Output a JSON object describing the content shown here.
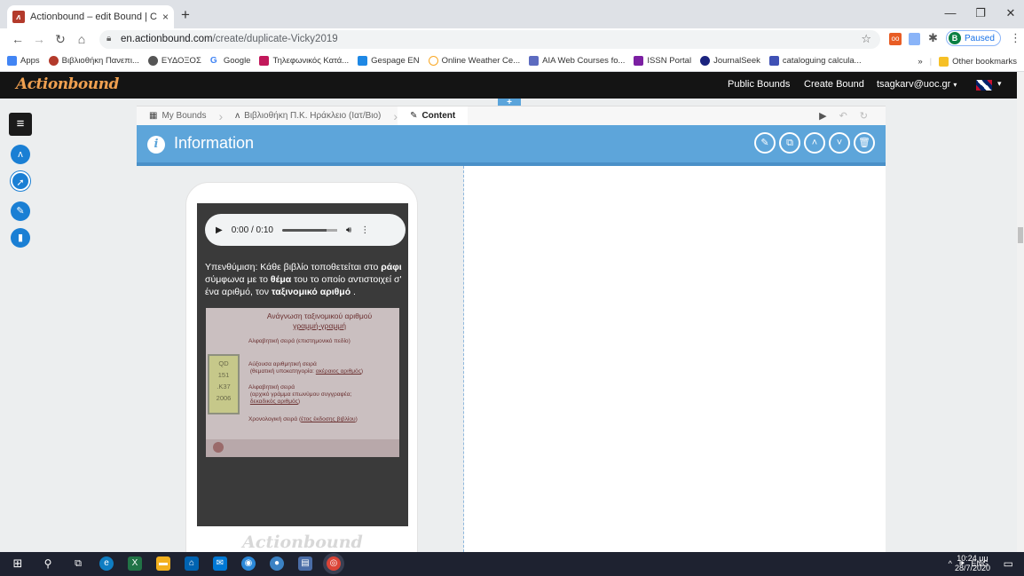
{
  "browser": {
    "tab_title": "Actionbound – edit Bound | Crea",
    "tab_close": "×",
    "new_tab": "+",
    "url_host": "en.actionbound.com",
    "url_path": "/create/duplicate-Vicky2019",
    "profile_letter": "B",
    "profile_status": "Paused",
    "bookmarks": [
      {
        "label": "Apps",
        "color": "#4285f4"
      },
      {
        "label": "Βιβλιοθήκη Πανεπι...",
        "color": "#b33a2b"
      },
      {
        "label": "ΕΥΔΟΞΟΣ",
        "color": "#555555"
      },
      {
        "label": "Google",
        "color": "#4285f4"
      },
      {
        "label": "Τηλεφωνικός Κατά...",
        "color": "#c2185b"
      },
      {
        "label": "Gespage EN",
        "color": "#1e88e5"
      },
      {
        "label": "Online Weather Ce...",
        "color": "#f9a825"
      },
      {
        "label": "AIA Web Courses fo...",
        "color": "#5c6bc0"
      },
      {
        "label": "ISSN Portal",
        "color": "#7b1fa2"
      },
      {
        "label": "JournalSeek",
        "color": "#1a237e"
      },
      {
        "label": "cataloguing calcula...",
        "color": "#3f51b5"
      }
    ],
    "bookmarks_more": "»",
    "other_bookmarks": "Other bookmarks"
  },
  "app": {
    "logo": "Actionbound",
    "nav": {
      "public_bounds": "Public Bounds",
      "create_bound": "Create Bound",
      "user": "tsagkarv@uoc.gr"
    },
    "breadcrumb": {
      "my_bounds": "My Bounds",
      "bound_name": "Βιβλιοθήκη Π.Κ. Ηράκλειο (Ιατ/Βιο)",
      "content": "Content"
    },
    "section": {
      "title": "Information"
    },
    "audio": {
      "time": "0:00 / 0:10"
    },
    "phone_text": {
      "p1": "Υπενθύμιση: Κάθε βιβλίο τοποθετείται στο ",
      "b1": "ράφι",
      "p2": " σύμφωνα με το ",
      "b2": "θέμα",
      "p3": " του το οποίο αντιστοιχεί σ' ένα αριθμό, τον ",
      "b3": "ταξινομικό αριθμό",
      "p4": " ."
    },
    "slide": {
      "title1": "Ανάγνωση ταξινομικού αριθμού",
      "title2": "γραμμή-γραμμή",
      "callnum": [
        "QD",
        "151",
        ".K37",
        "2006"
      ],
      "line1": "Αλφαβητική σειρά (επιστημονικό πεδίο)",
      "line2a": "Αύξουσα αριθμητική σειρά",
      "line2b": "(θεματική υποκατηγορία: ",
      "line2c": "ακέραιος αριθμός",
      "line2d": ")",
      "line3a": "Αλφαβητική σειρά",
      "line3b": "(αρχικό γράμμα επωνύμου συγγραφέα;",
      "line3c": "δεκαδικός αριθμός",
      "line3d": ")",
      "line4a": "Χρονολογική σειρά (",
      "line4b": "έτος έκδοσης βιβλίου",
      "line4c": ")"
    },
    "phone_logo": "Actionbound"
  },
  "taskbar": {
    "lang": "ENG",
    "time": "10:24 μμ",
    "date": "28/7/2020"
  }
}
